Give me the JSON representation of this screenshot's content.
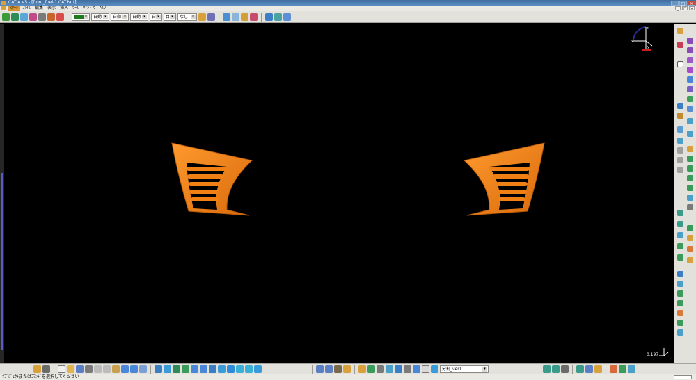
{
  "window": {
    "title": "CATIA V5 - [front_fuel-1.CATPart]",
    "minimize_label": "_",
    "maximize_label": "□",
    "close_label": "×"
  },
  "menu": {
    "items": [
      "ｽﾀｰﾄ",
      "ﾌｧｲﾙ",
      "編集",
      "表示",
      "挿入",
      "ﾂｰﾙ",
      "ｳｨﾝﾄﾞｳ",
      "ﾍﾙﾌﾟ"
    ],
    "doc_buttons": [
      "_",
      "□",
      "×"
    ]
  },
  "toolbar_top": {
    "color_value": "#1b7d1b",
    "transparency_value": "自動",
    "line_thickness_value": "自動",
    "line_type_value": "自動",
    "point_symbol_value": "自動",
    "layer_value": "目目",
    "rendering_value": "なし"
  },
  "toolbar_bottom": {
    "current_body_value": "分割_ver1"
  },
  "viewport": {
    "scale_value": "0.197",
    "compass_axes": [
      "x",
      "y",
      "z"
    ],
    "part_color": "#f07f14"
  },
  "status": {
    "message": "ｵﾌﾞｼﾞｪｸﾄまたはｺﾏﾝﾄﾞを選択してください"
  }
}
